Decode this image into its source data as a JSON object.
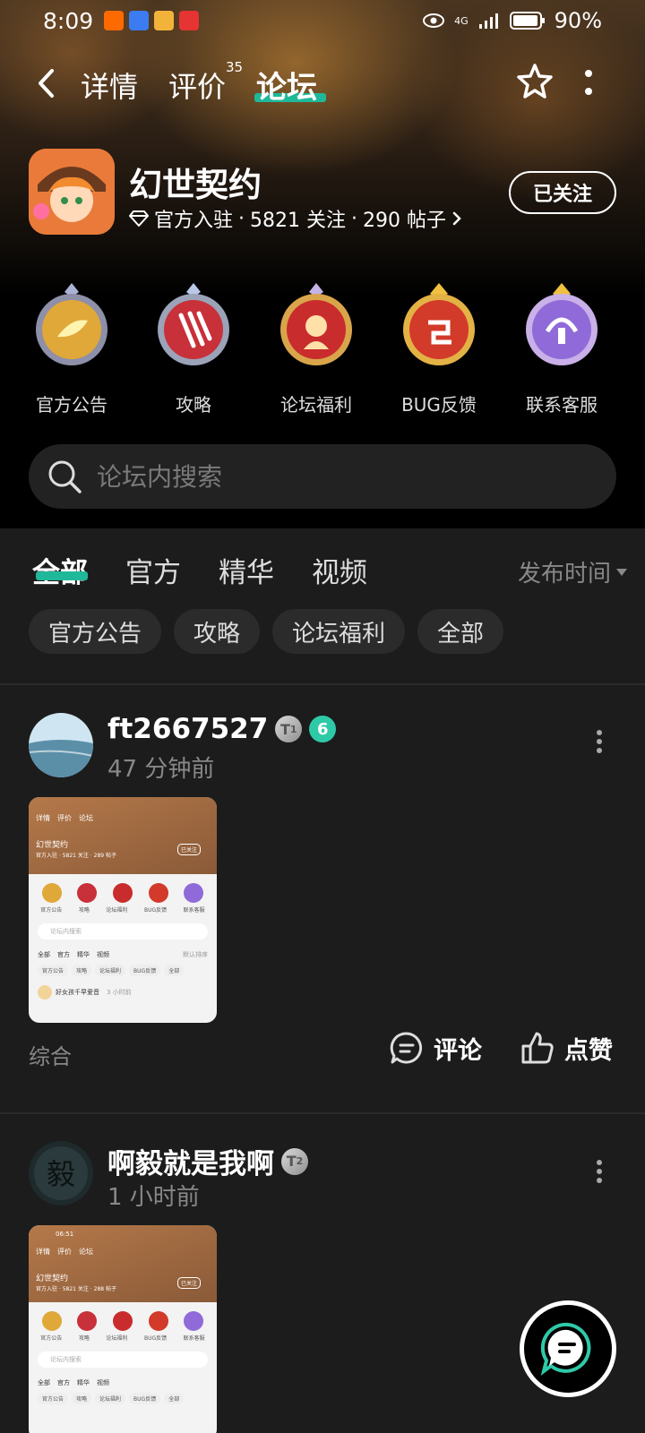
{
  "status_bar": {
    "time": "8:09",
    "network": "4G",
    "battery": "90%"
  },
  "nav": {
    "tabs": [
      {
        "label": "详情"
      },
      {
        "label": "评价",
        "badge": "35"
      },
      {
        "label": "论坛",
        "active": true
      }
    ]
  },
  "app": {
    "name": "幻世契约",
    "official": "官方入驻",
    "followers": "5821 关注",
    "posts": "290 帖子",
    "follow_button": "已关注"
  },
  "categories": [
    {
      "label": "官方公告",
      "icon": "announcement-emblem-icon",
      "color": "#e0a838"
    },
    {
      "label": "攻略",
      "icon": "guide-emblem-icon",
      "color": "#c8303a"
    },
    {
      "label": "论坛福利",
      "icon": "welfare-emblem-icon",
      "color": "#c92c2c"
    },
    {
      "label": "BUG反馈",
      "icon": "bug-report-emblem-icon",
      "color": "#d23a2a"
    },
    {
      "label": "联系客服",
      "icon": "customer-service-emblem-icon",
      "color": "#8f6ad8"
    }
  ],
  "search": {
    "placeholder": "论坛内搜索"
  },
  "filter_tabs": [
    {
      "label": "全部",
      "active": true
    },
    {
      "label": "官方"
    },
    {
      "label": "精华"
    },
    {
      "label": "视频"
    }
  ],
  "sort": {
    "label": "发布时间"
  },
  "chips": [
    "官方公告",
    "攻略",
    "论坛福利",
    "全部"
  ],
  "posts": [
    {
      "username": "ft2667527",
      "level": "1",
      "time": "47 分钟前",
      "tag": "综合",
      "thumb": {
        "title": "幻世契约",
        "meta": "官方入驻 · 5821 关注 · 289 帖子",
        "follow": "已关注",
        "tabs": [
          "详情",
          "评价",
          "论坛"
        ],
        "cats": [
          "官方公告",
          "攻略",
          "论坛福利",
          "BUG反馈",
          "联系客服"
        ],
        "search": "论坛内搜索",
        "ftabs": [
          "全部",
          "官方",
          "精华",
          "视频"
        ],
        "sort": "默认排序",
        "chips": [
          "官方公告",
          "攻略",
          "论坛福利",
          "BUG反馈",
          "全部"
        ],
        "user": "好女孩千早爱音",
        "utime": "3 小时前"
      }
    },
    {
      "username": "啊毅就是我啊",
      "level": "2",
      "time": "1 小时前",
      "thumb": {
        "title": "幻世契约",
        "meta": "官方入驻 · 5821 关注 · 288 帖子",
        "follow": "已关注",
        "tabs": [
          "详情",
          "评价",
          "论坛"
        ],
        "cats": [
          "官方公告",
          "攻略",
          "论坛福利",
          "BUG反馈",
          "联系客服"
        ],
        "search": "论坛内搜索",
        "ftabs": [
          "全部",
          "官方",
          "精华",
          "视频"
        ],
        "chips": [
          "官方公告",
          "攻略",
          "论坛福利",
          "BUG反馈",
          "全部"
        ],
        "clock": "06:51"
      }
    }
  ],
  "actions": {
    "comment": "评论",
    "like": "点赞"
  }
}
